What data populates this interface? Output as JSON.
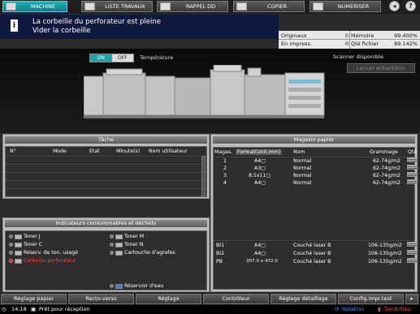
{
  "tabs": [
    {
      "label": "MACHINE"
    },
    {
      "label": "LISTE TRAVAUX"
    },
    {
      "label": "RAPPEL DD"
    },
    {
      "label": "COPIER"
    },
    {
      "label": "NUMERISER"
    }
  ],
  "message": {
    "line1": "La corbeille du perforateur est pleine",
    "line2": "Vider la corbeille"
  },
  "counters": {
    "originaux_label": "Originaux",
    "originaux_value": "0",
    "memoire_label": "Mémoire",
    "memoire_value": "99.400%",
    "impress_label": "En impress.",
    "impress_value": "0",
    "fichier_label": "Qté fichier",
    "fichier_value": "89.142%"
  },
  "machine": {
    "on_label": "ON",
    "off_label": "OFF",
    "temperature_label": "Température",
    "scanner_status": "Scanner disponible",
    "sample_button": "Lancer échantillon"
  },
  "tache": {
    "title": "Tâche",
    "columns": [
      "N°",
      "Mode",
      "Etat",
      "Minute(s)",
      "Nom utilisateur"
    ]
  },
  "consommables": {
    "title": "Indicateurs consommables et déchets",
    "items": [
      {
        "label": "Toner J"
      },
      {
        "label": "Toner M"
      },
      {
        "label": "Toner C"
      },
      {
        "label": "Toner N"
      },
      {
        "label": "Réserv. de ton. usagé"
      },
      {
        "label": "Cartouche d'agrafes"
      },
      {
        "label": "Corbeille perforateur"
      },
      {
        "label": "Réservoir d'eau"
      }
    ]
  },
  "magasin": {
    "title": "Magasin papier",
    "columns": [
      "Magas.",
      "Format(Unit.mm)",
      "Nom",
      "Grammage",
      "Qté"
    ],
    "rows": [
      {
        "tray": "1",
        "format": "A4▢",
        "name": "Normal",
        "weight": "62-74g/m2"
      },
      {
        "tray": "2",
        "format": "A3▢",
        "name": "Normal",
        "weight": "62-74g/m2"
      },
      {
        "tray": "3",
        "format": "8.5x11▢",
        "name": "Normal",
        "weight": "62-74g/m2"
      },
      {
        "tray": "4",
        "format": "A4▢",
        "name": "Normal",
        "weight": "62-74g/m2"
      },
      {
        "tray": "BI1",
        "format": "A4▢",
        "name": "Couché laser B",
        "weight": "106-135g/m2"
      },
      {
        "tray": "BI2",
        "format": "A4▢",
        "name": "Couché laser B",
        "weight": "106-135g/m2"
      },
      {
        "tray": "PB",
        "format": "307.0 x 472.0",
        "name": "Couché laser B",
        "weight": "106-135g/m2"
      }
    ]
  },
  "bottom_buttons": [
    {
      "label": "Réglage papier"
    },
    {
      "label": "Recto-verso"
    },
    {
      "label": "Réglage"
    },
    {
      "label": "Contrôleur"
    },
    {
      "label": "Réglage détaillage"
    },
    {
      "label": "Config.impr.test"
    }
  ],
  "status": {
    "time": "14:18",
    "message": "Prêt pour réception",
    "rotation": "Rotation",
    "tamb": "Tamb/Dév."
  }
}
